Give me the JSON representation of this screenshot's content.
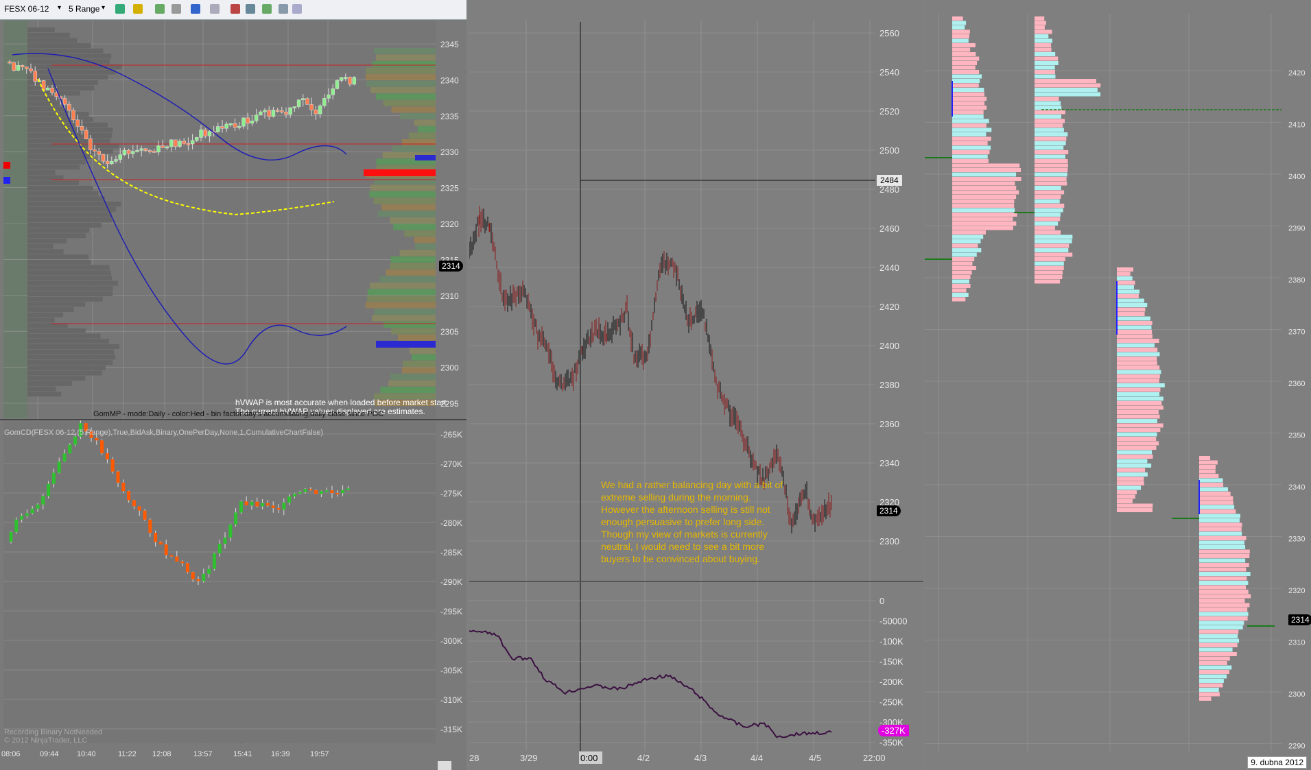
{
  "toolbar": {
    "instrument": "FESX 06-12",
    "period": "5 Range"
  },
  "left_chart": {
    "price_axis": [
      "2345",
      "2340",
      "2335",
      "2330",
      "2325",
      "2320",
      "2315",
      "2310",
      "2305",
      "2300",
      "2295"
    ],
    "current_price": "2314",
    "hvwap_note_1": "hVWAP is most accurate when loaded before market start.",
    "hvwap_note_2": "The current hVWAP values displayed are estimates.",
    "gommp_label": "GomMP - mode:Daily - color:Hed - bin factor:day's accumulating,daily close since POC",
    "cd_label": "GomCD(FESX 06-12 (5 Range),True,BidAsk,Binary,OnePerDay,None,1,CumulativeChartFalse)",
    "cd_axis": [
      "-265K",
      "-270K",
      "-275K",
      "-280K",
      "-285K",
      "-290K",
      "-295K",
      "-300K",
      "-305K",
      "-310K",
      "-315K"
    ],
    "time_axis": [
      "08:06",
      "09:44",
      "10:40",
      "11:22",
      "12:08",
      "13:57",
      "15:41",
      "16:39",
      "19:57"
    ],
    "recording": "Recording Binary NotNeeded",
    "copyright": "© 2012 NinjaTrader, LLC"
  },
  "middle_chart": {
    "price_axis": [
      "2560",
      "2540",
      "2520",
      "2500",
      "2480",
      "2460",
      "2440",
      "2420",
      "2400",
      "2380",
      "2360",
      "2340",
      "2320",
      "2300"
    ],
    "crosshair_price": "2484",
    "current_price": "2314",
    "cd_axis": [
      "0",
      "-50000",
      "-100K",
      "-150K",
      "-200K",
      "-250K",
      "-300K",
      "-350K"
    ],
    "cd_current": "-327K",
    "date_axis": [
      "28",
      "3/29",
      "0:00",
      "4/2",
      "4/3",
      "4/4",
      "4/5",
      "22:00"
    ],
    "comment": "We had a rather balancing day with a bit of extreme selling during the morning. However the afternoon selling is still not enough persuasive to prefer long side. Though my view of markets is currently neutral, I would need to see a bit more buyers to be convinced about buying."
  },
  "right_chart": {
    "price_axis": [
      "2420",
      "2410",
      "2400",
      "2390",
      "2380",
      "2370",
      "2360",
      "2350",
      "2340",
      "2330",
      "2320",
      "2310",
      "2300",
      "2290"
    ],
    "current_price": "2314",
    "date_label": "9. dubna 2012"
  },
  "colors": {
    "bull": "#90ee90",
    "bear": "#ff7f50",
    "vwap": "#ffff00",
    "ma": "#1e1eb4",
    "level": "#cc2222",
    "profile_sell": "#ffb6c1",
    "profile_buy": "#aff0f0",
    "comment": "#e6b800"
  }
}
